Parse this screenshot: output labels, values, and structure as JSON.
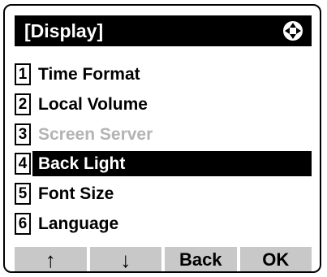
{
  "header": {
    "title": "[Display]",
    "icon": "four-way-navigation-icon"
  },
  "menu": {
    "items": [
      {
        "number": "1",
        "label": "Time Format",
        "state": "normal"
      },
      {
        "number": "2",
        "label": "Local Volume",
        "state": "normal"
      },
      {
        "number": "3",
        "label": "Screen Server",
        "state": "disabled"
      },
      {
        "number": "4",
        "label": "Back Light",
        "state": "selected"
      },
      {
        "number": "5",
        "label": "Font Size",
        "state": "normal"
      },
      {
        "number": "6",
        "label": "Language",
        "state": "normal"
      }
    ]
  },
  "softkeys": {
    "up": "↑",
    "down": "↓",
    "back": "Back",
    "ok": "OK"
  },
  "colors": {
    "highlight": "#000000",
    "disabled_text": "#b4b4b4",
    "softkey_bg": "#c8c8c8"
  }
}
